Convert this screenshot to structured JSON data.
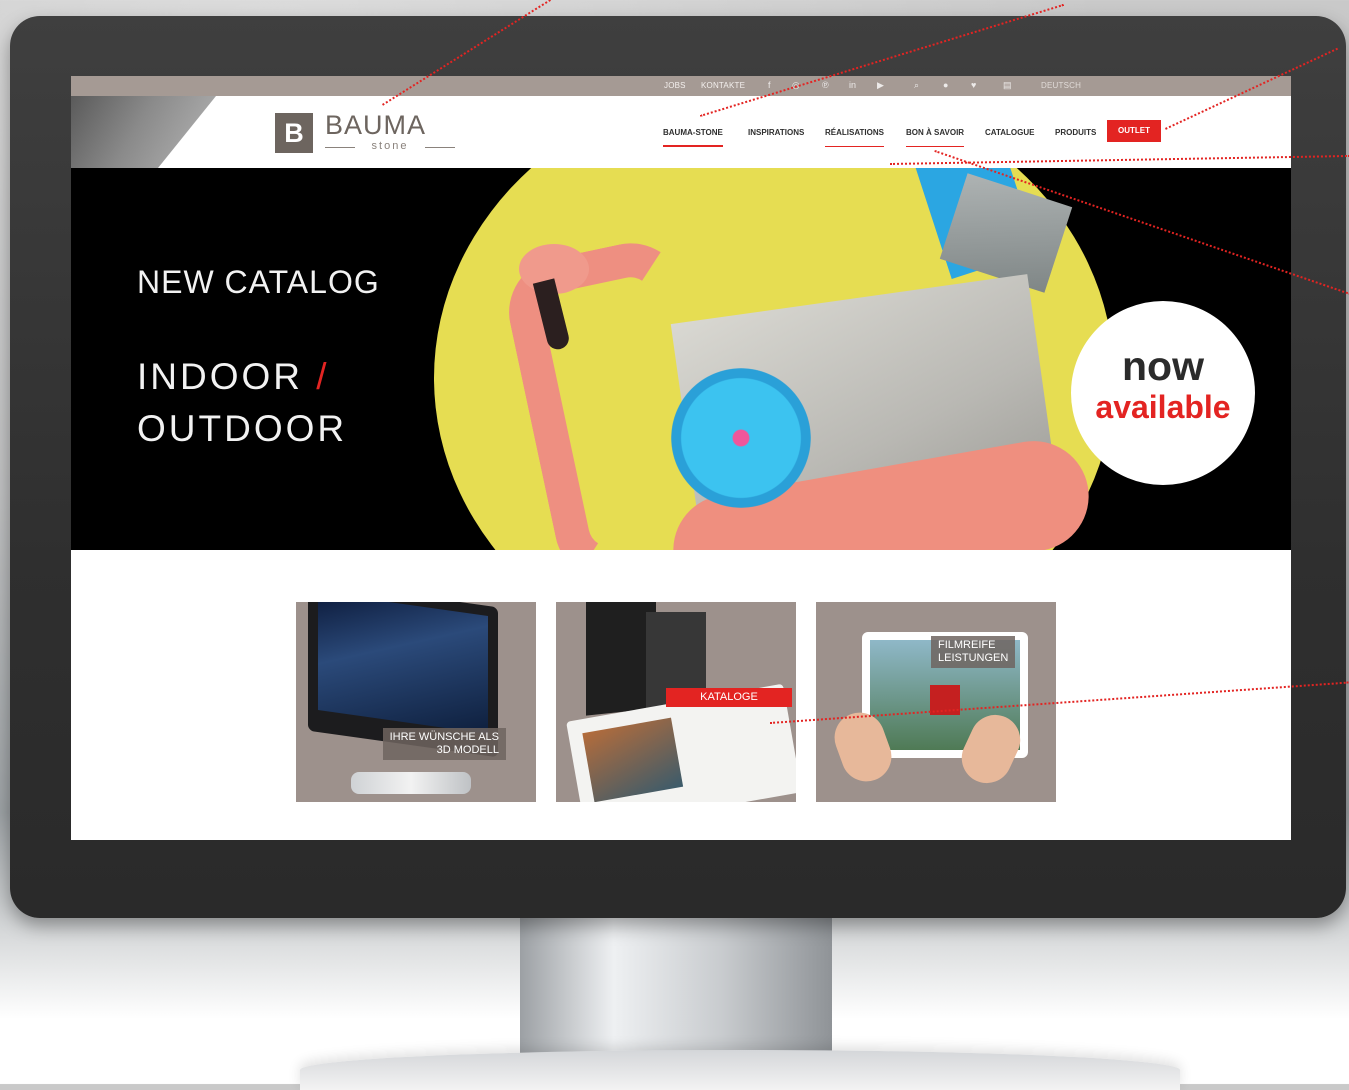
{
  "topbar": {
    "links": [
      "JOBS",
      "KONTAKTE"
    ],
    "social_icons": [
      "facebook-icon",
      "instagram-icon",
      "pinterest-icon",
      "linkedin-icon",
      "youtube-icon"
    ],
    "tool_icons": [
      "search-icon",
      "user-icon",
      "heart-icon",
      "document-icon"
    ],
    "language": "DEUTSCH"
  },
  "logo": {
    "text": "BAUMA",
    "sub": "stone",
    "mark": "B"
  },
  "nav": {
    "items": [
      "BAUMA-STONE",
      "INSPIRATIONS",
      "RÉALISATIONS",
      "BON À SAVOIR",
      "CATALOGUE",
      "PRODUITS"
    ],
    "outlet": "OUTLET"
  },
  "hero": {
    "line1": "NEW CATALOG",
    "line2_a": "INDOOR ",
    "line2_slash": "/",
    "line3": "OUTDOOR",
    "badge_now": "now",
    "badge_available": "available"
  },
  "tiles": [
    {
      "label_line1": "IHRE WÜNSCHE ALS",
      "label_line2": "3D MODELL"
    },
    {
      "label_line1": "KATALOGE"
    },
    {
      "label_line1": "FILMREIFE",
      "label_line2": "LEISTUNGEN"
    }
  ],
  "colors": {
    "accent": "#e32422",
    "topbar": "#a59a94",
    "brand": "#6d655f",
    "hero_yellow": "#e6dd52"
  }
}
